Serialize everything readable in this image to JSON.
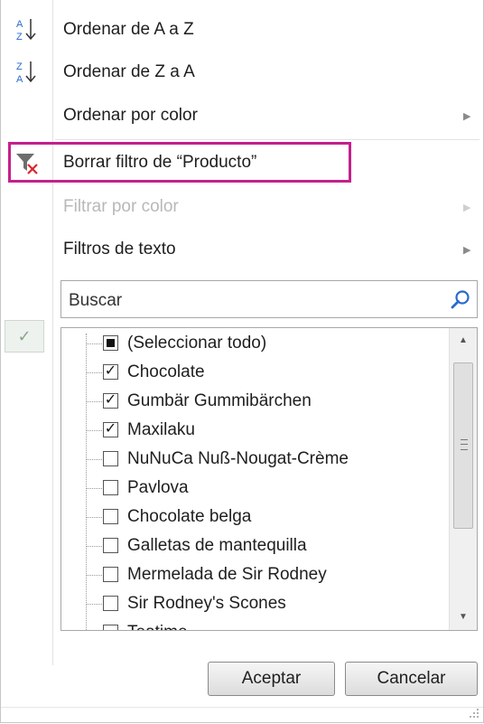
{
  "menu": {
    "sort_az": "Ordenar de A a Z",
    "sort_za": "Ordenar de Z a A",
    "sort_by_color": "Ordenar por color",
    "clear_filter": "Borrar filtro de “Producto”",
    "filter_by_color": "Filtrar por color",
    "text_filters": "Filtros de texto"
  },
  "search": {
    "placeholder": "Buscar"
  },
  "list": {
    "items": [
      {
        "label": "(Seleccionar todo)",
        "state": "partial"
      },
      {
        "label": "Chocolate",
        "state": "checked"
      },
      {
        "label": "Gumbär Gummibärchen",
        "state": "checked"
      },
      {
        "label": "Maxilaku",
        "state": "checked"
      },
      {
        "label": "NuNuCa Nuß-Nougat-Crème",
        "state": "unchecked"
      },
      {
        "label": "Pavlova",
        "state": "unchecked"
      },
      {
        "label": "Chocolate belga",
        "state": "unchecked"
      },
      {
        "label": "Galletas de mantequilla",
        "state": "unchecked"
      },
      {
        "label": "Mermelada de Sir Rodney",
        "state": "unchecked"
      },
      {
        "label": "Sir Rodney's Scones",
        "state": "unchecked"
      },
      {
        "label": "Teatime",
        "state": "unchecked"
      }
    ]
  },
  "buttons": {
    "ok": "Aceptar",
    "cancel": "Cancelar"
  },
  "colors": {
    "highlight": "#c5208c",
    "clear_filter_red": "#d9262b"
  },
  "icons": {
    "sort_az": "sort-ascending-icon",
    "sort_za": "sort-descending-icon",
    "clear_filter": "clear-filter-icon",
    "search": "magnifier-icon",
    "check": "checkmark-icon"
  }
}
